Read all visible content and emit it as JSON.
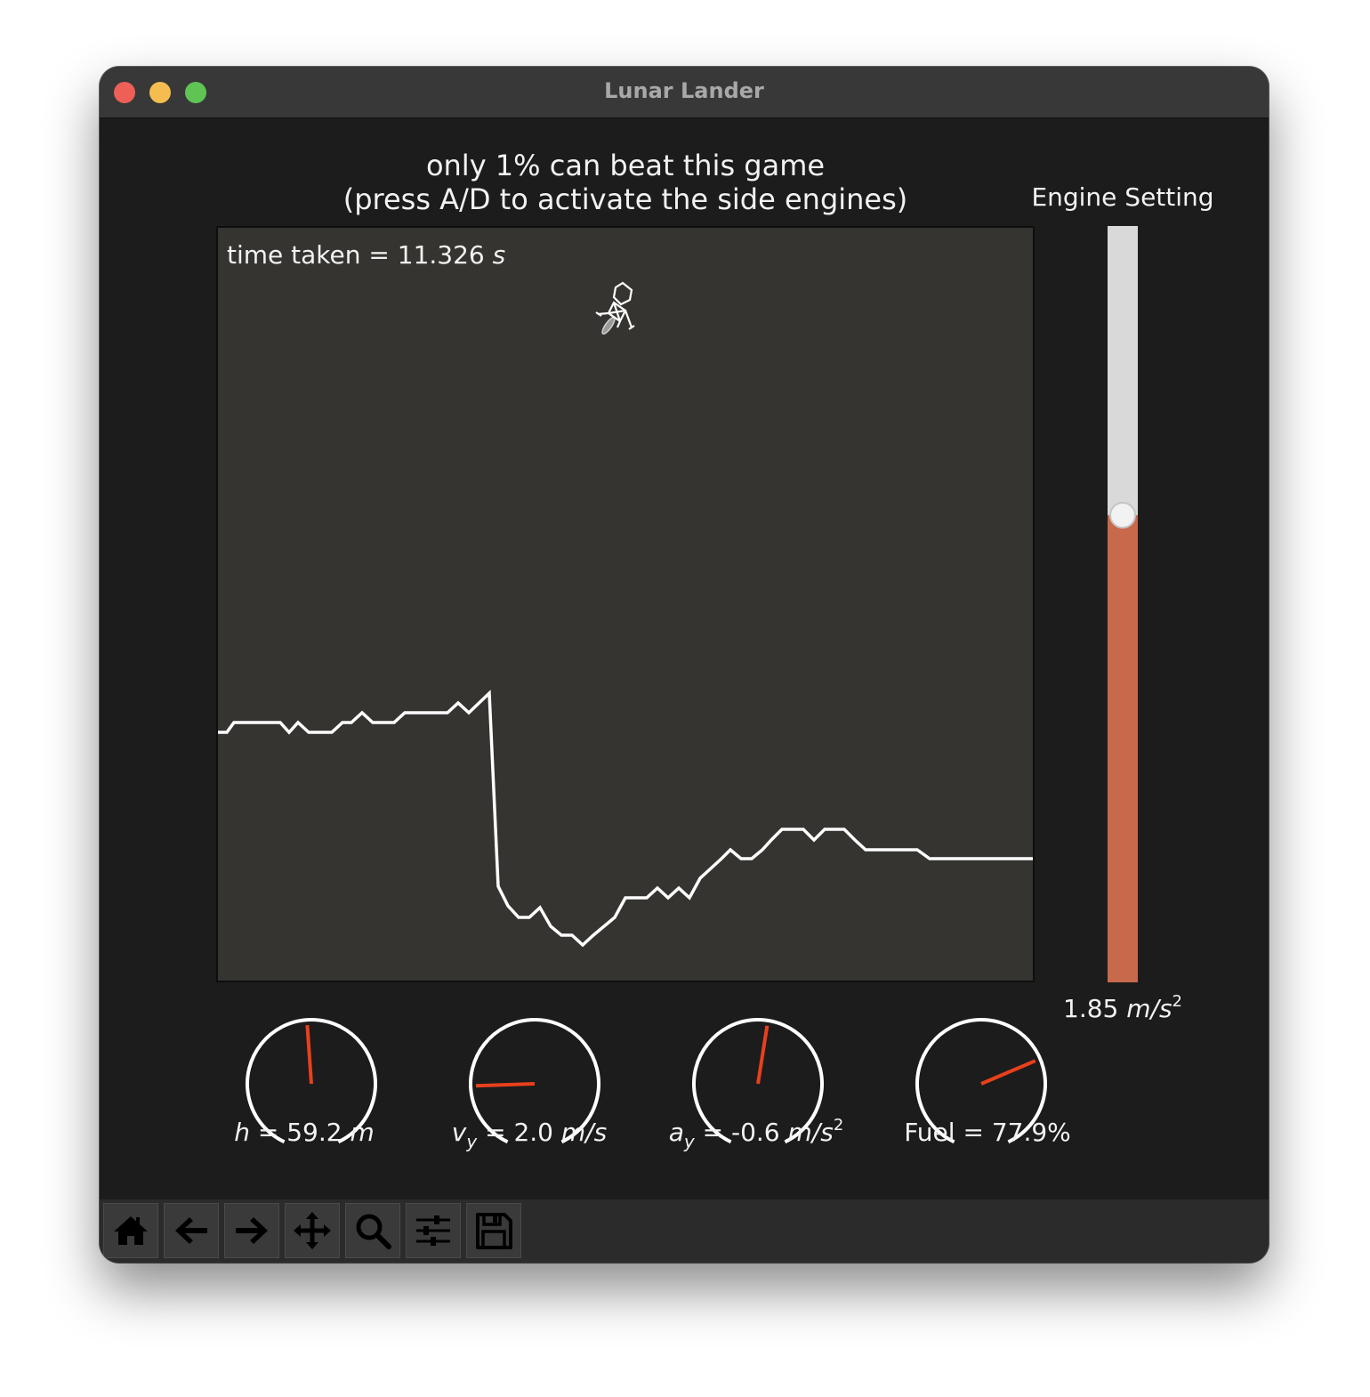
{
  "window": {
    "title": "Lunar Lander",
    "buttons": [
      "close",
      "minimize",
      "maximize"
    ]
  },
  "headline": {
    "line1": "only 1% can beat this game",
    "line2": "(press A/D to activate the side engines)"
  },
  "game": {
    "time_label": "time taken = 11.326",
    "time_unit": "s",
    "lander_icon": "lunar-lander-icon",
    "terrain": [
      [
        0,
        567
      ],
      [
        10,
        567
      ],
      [
        18,
        556
      ],
      [
        70,
        556
      ],
      [
        80,
        567
      ],
      [
        90,
        556
      ],
      [
        102,
        567
      ],
      [
        128,
        567
      ],
      [
        140,
        556
      ],
      [
        150,
        556
      ],
      [
        162,
        545
      ],
      [
        174,
        556
      ],
      [
        198,
        556
      ],
      [
        210,
        545
      ],
      [
        258,
        545
      ],
      [
        270,
        534
      ],
      [
        282,
        545
      ],
      [
        305,
        523
      ],
      [
        315,
        740
      ],
      [
        326,
        762
      ],
      [
        338,
        775
      ],
      [
        350,
        775
      ],
      [
        362,
        764
      ],
      [
        374,
        785
      ],
      [
        386,
        795
      ],
      [
        398,
        795
      ],
      [
        410,
        806
      ],
      [
        422,
        795
      ],
      [
        434,
        785
      ],
      [
        446,
        775
      ],
      [
        458,
        753
      ],
      [
        482,
        753
      ],
      [
        494,
        742
      ],
      [
        506,
        753
      ],
      [
        518,
        742
      ],
      [
        530,
        753
      ],
      [
        542,
        731
      ],
      [
        554,
        720
      ],
      [
        566,
        709
      ],
      [
        576,
        699
      ],
      [
        588,
        709
      ],
      [
        600,
        709
      ],
      [
        612,
        699
      ],
      [
        622,
        688
      ],
      [
        634,
        676
      ],
      [
        658,
        676
      ],
      [
        670,
        688
      ],
      [
        682,
        676
      ],
      [
        704,
        676
      ],
      [
        716,
        688
      ],
      [
        728,
        699
      ],
      [
        786,
        699
      ],
      [
        800,
        709
      ],
      [
        918,
        709
      ]
    ],
    "colors": {
      "background": "#353430",
      "terrain": "#ffffff",
      "lander": "#ffffff"
    }
  },
  "engine": {
    "label": "Engine Setting",
    "value_text": "1.85",
    "unit_text": "m/s",
    "unit_exp": "2",
    "fill_fraction": 0.618,
    "fill_color": "#c8694c",
    "track_color": "#d9d9d9"
  },
  "gauges": [
    {
      "name": "height",
      "needle_angle_deg": -4,
      "symbol": "h",
      "sub": "",
      "value": "= 59.2",
      "unit": "m",
      "exp": ""
    },
    {
      "name": "vertical-velocity",
      "needle_angle_deg": -92,
      "symbol": "v",
      "sub": "y",
      "value": "= 2.0",
      "unit": "m/s",
      "exp": ""
    },
    {
      "name": "vertical-acceleration",
      "needle_angle_deg": 9,
      "symbol": "a",
      "sub": "y",
      "value": "= -0.6",
      "unit": "m/s",
      "exp": "2"
    },
    {
      "name": "fuel",
      "needle_angle_deg": 67,
      "symbol": "Fuel",
      "sub": "",
      "value": "=  77.9%",
      "unit": "",
      "exp": ""
    }
  ],
  "gauge_colors": {
    "arc": "#ffffff",
    "needle": "#e8401c"
  },
  "toolbar": {
    "buttons": [
      "home-icon",
      "back-arrow-icon",
      "forward-arrow-icon",
      "pan-icon",
      "zoom-icon",
      "configure-subplots-icon",
      "save-icon"
    ]
  }
}
